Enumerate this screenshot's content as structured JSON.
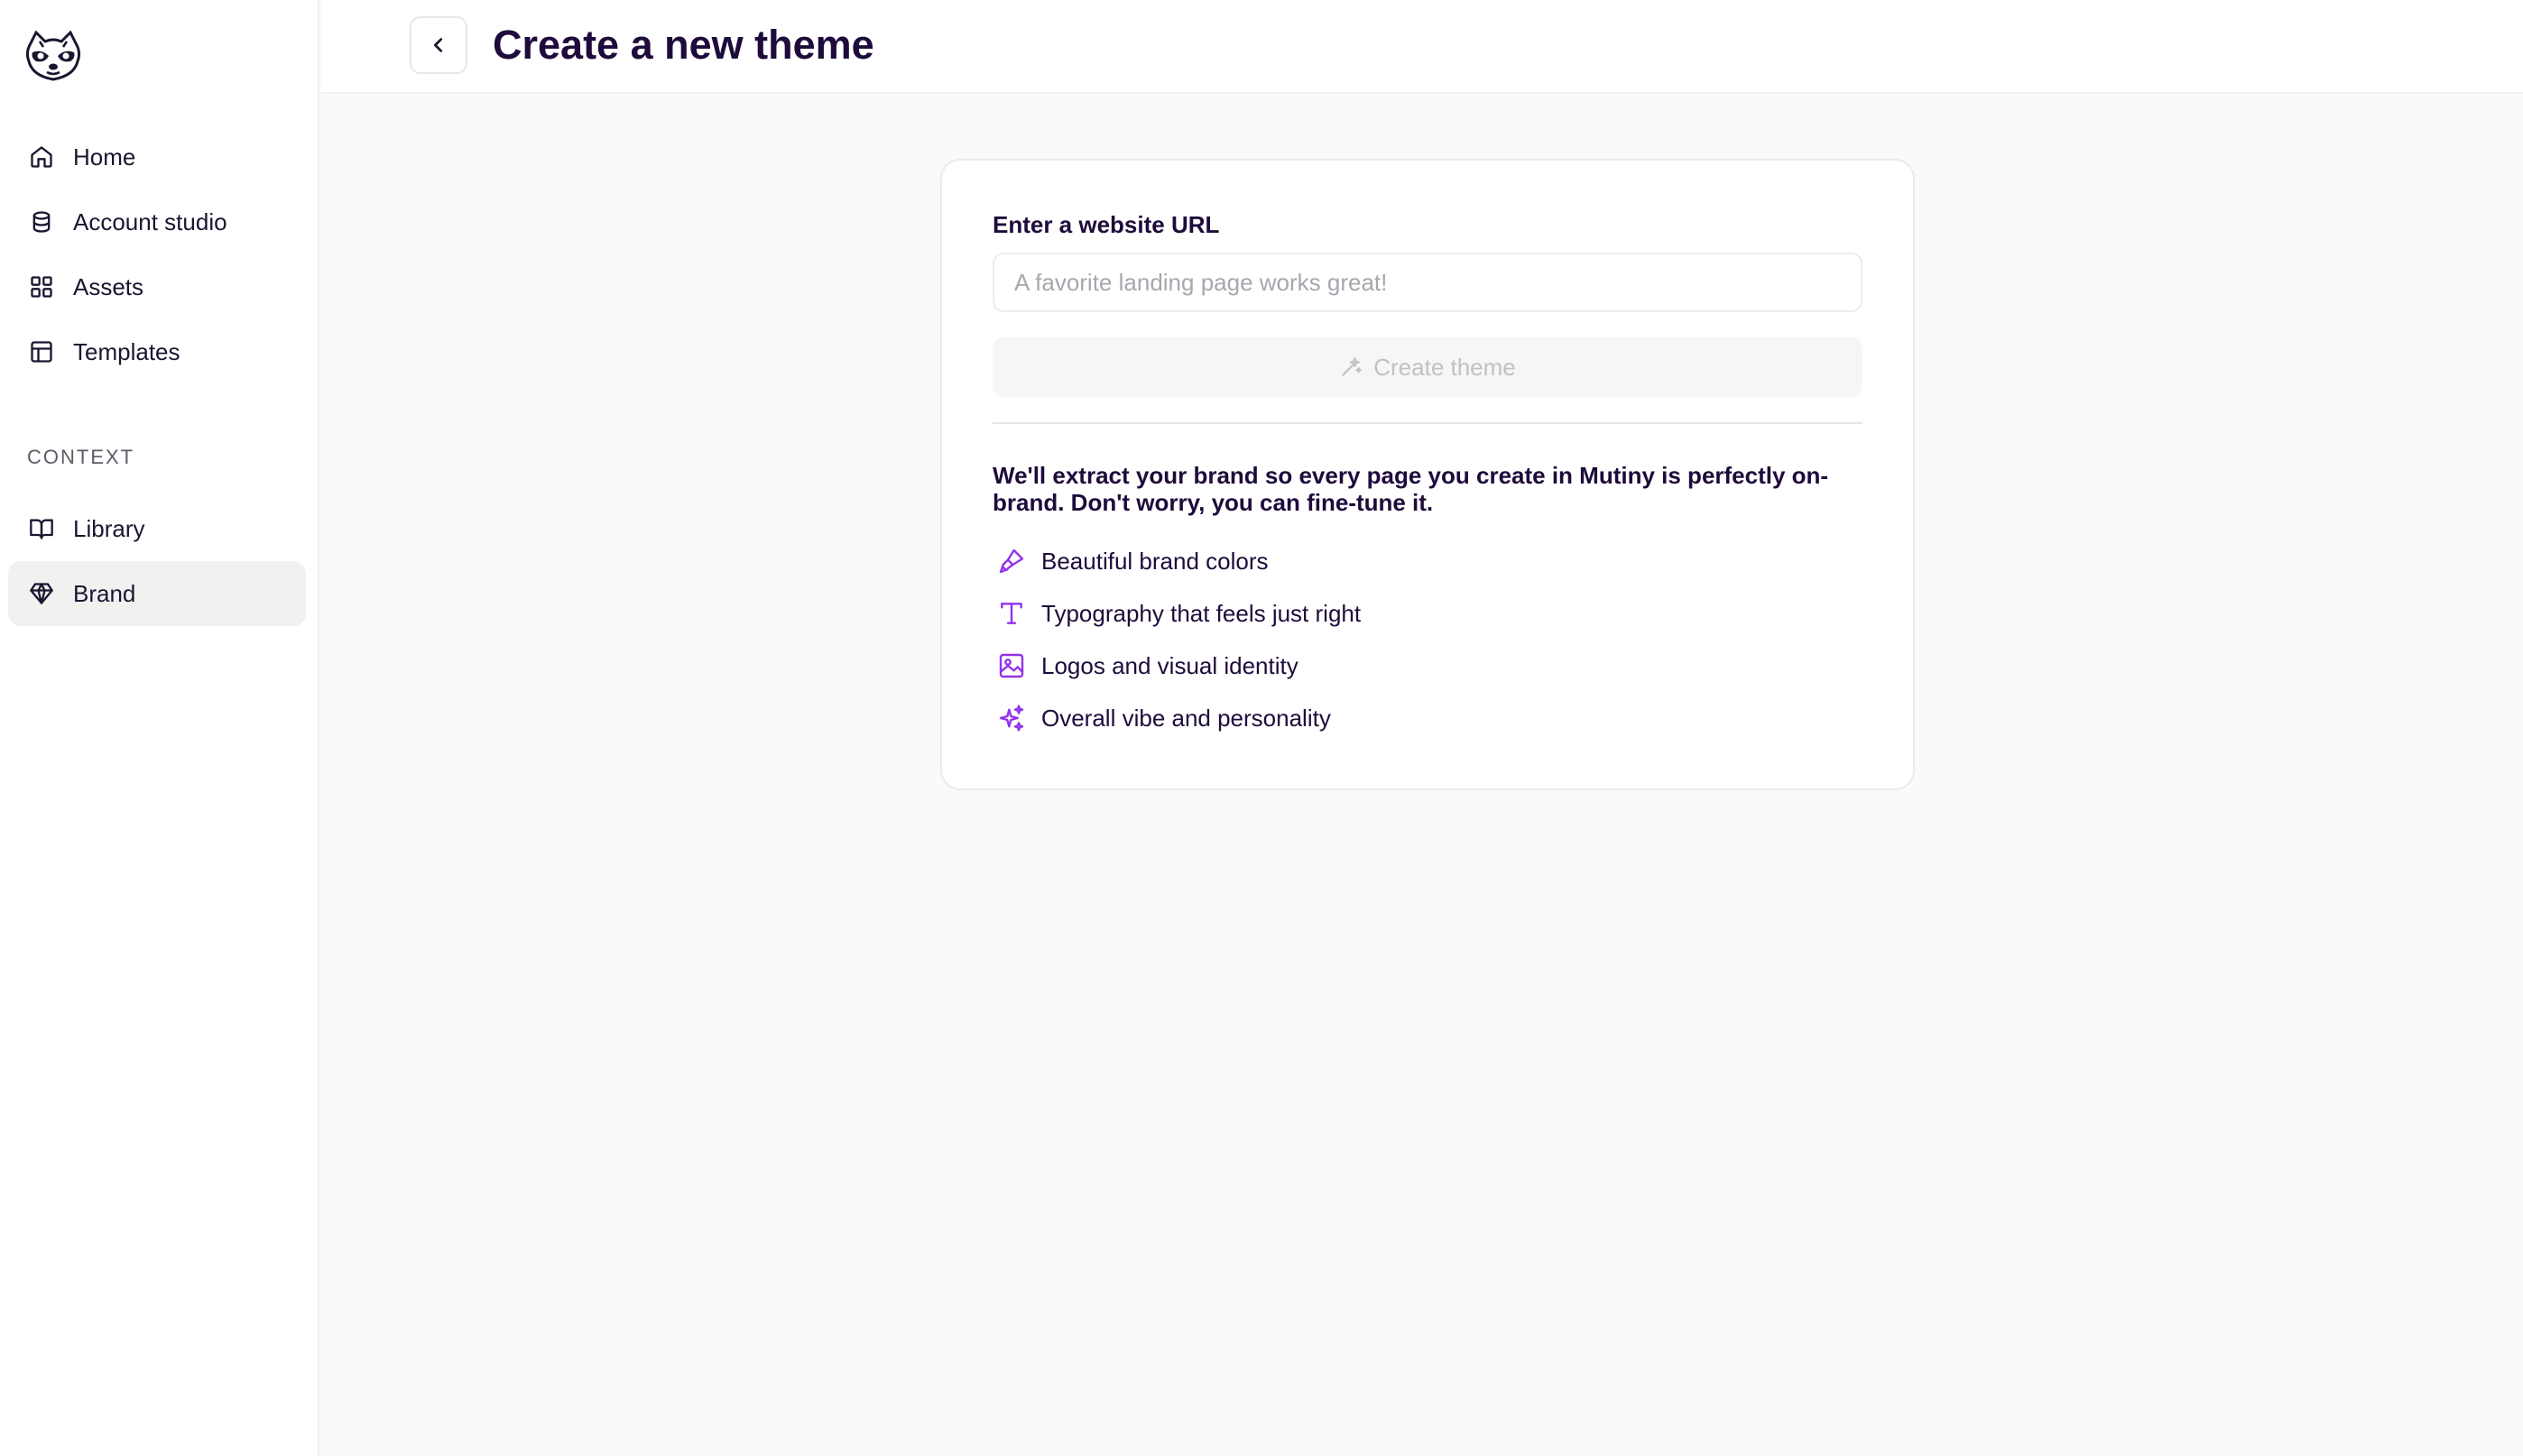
{
  "sidebar": {
    "items": [
      {
        "label": "Home",
        "icon": "home-icon"
      },
      {
        "label": "Account studio",
        "icon": "database-icon"
      },
      {
        "label": "Assets",
        "icon": "grid-icon"
      },
      {
        "label": "Templates",
        "icon": "layout-icon"
      }
    ],
    "section_label": "CONTEXT",
    "context_items": [
      {
        "label": "Library",
        "icon": "book-icon"
      },
      {
        "label": "Brand",
        "icon": "gem-icon",
        "active": true
      }
    ]
  },
  "header": {
    "title": "Create a new theme"
  },
  "form": {
    "url_label": "Enter a website URL",
    "url_placeholder": "A favorite landing page works great!",
    "url_value": "",
    "create_button_label": "Create theme",
    "create_button_disabled": true,
    "description": "We'll extract your brand so every page you create in Mutiny is perfectly on-brand. Don't worry, you can fine-tune it.",
    "features": [
      {
        "label": "Beautiful brand colors",
        "icon": "paintbrush-icon"
      },
      {
        "label": "Typography that feels just right",
        "icon": "type-icon"
      },
      {
        "label": "Logos and visual identity",
        "icon": "image-icon"
      },
      {
        "label": "Overall vibe and personality",
        "icon": "sparkles-icon"
      }
    ]
  },
  "colors": {
    "accent": "#9333ea",
    "title": "#1e0b3b",
    "active_nav_bg": "#f1f1f0"
  }
}
